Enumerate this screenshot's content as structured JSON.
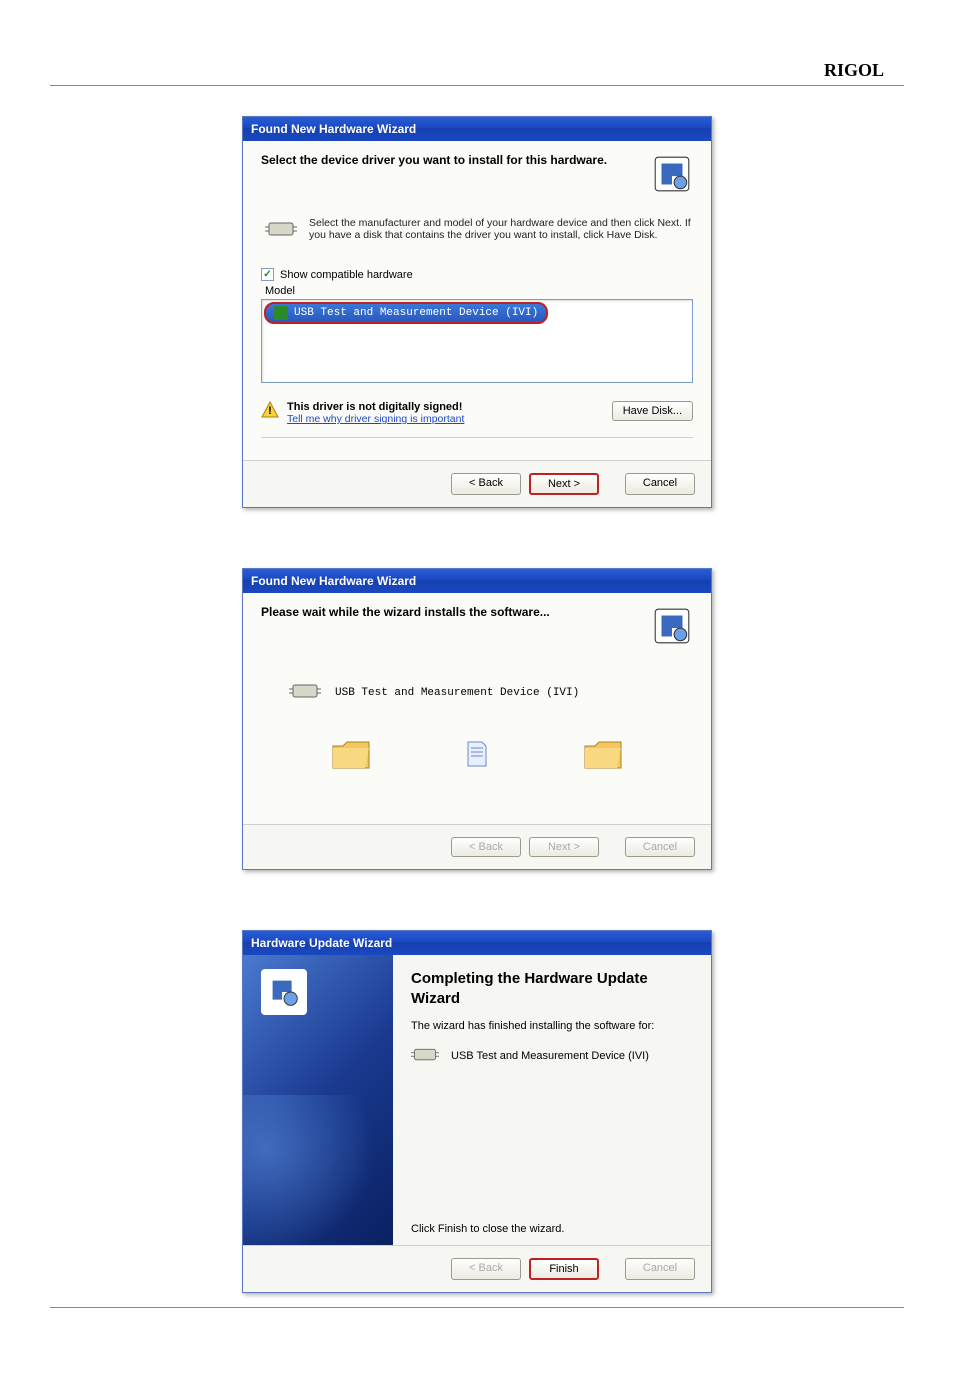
{
  "header": {
    "brand": "RIGOL"
  },
  "dialog1": {
    "title": "Found New Hardware Wizard",
    "heading": "Select the device driver you want to install for this hardware.",
    "instructions": "Select the manufacturer and model of your hardware device and then click Next. If you have a disk that contains the driver you want to install, click Have Disk.",
    "checkbox_label": "Show compatible hardware",
    "list_label": "Model",
    "selected_item": "USB Test and Measurement Device (IVI)",
    "warning": "This driver is not digitally signed!",
    "warning_link": "Tell me why driver signing is important",
    "have_disk": "Have Disk...",
    "back": "< Back",
    "next": "Next >",
    "cancel": "Cancel"
  },
  "dialog2": {
    "title": "Found New Hardware Wizard",
    "heading": "Please wait while the wizard installs the software...",
    "item": "USB Test and Measurement Device (IVI)",
    "back": "< Back",
    "next": "Next >",
    "cancel": "Cancel"
  },
  "dialog3": {
    "title": "Hardware Update Wizard",
    "heading": "Completing the Hardware Update Wizard",
    "sub": "The wizard has finished installing the software for:",
    "item": "USB Test and Measurement Device (IVI)",
    "close_text": "Click Finish to close the wizard.",
    "back": "< Back",
    "finish": "Finish",
    "cancel": "Cancel"
  }
}
